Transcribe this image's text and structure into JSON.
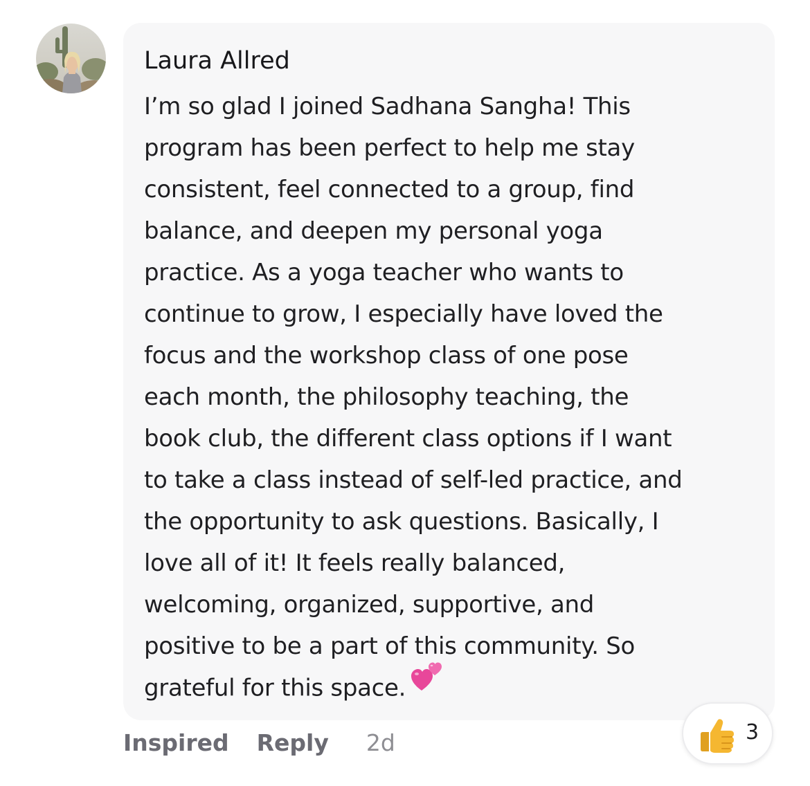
{
  "comment": {
    "author": "Laura Allred",
    "lines": [
      "I’m so glad I joined Sadhana Sangha! This",
      "program has been perfect to help me stay",
      "consistent, feel connected to a group, find",
      "balance, and deepen my personal yoga",
      "practice. As a yoga teacher who wants to",
      "continue to grow, I especially have loved the",
      "focus and the workshop class of one pose",
      "each month, the philosophy teaching, the",
      "book club, the different class options if I want",
      "to take a class instead of self-led practice, and",
      "the opportunity to ask questions. Basically, I",
      "love all of it! It feels really balanced,",
      "welcoming, organized, supportive, and",
      "positive to be a part of this community. So",
      "grateful for this space."
    ],
    "trailing_emoji": "two-hearts-icon"
  },
  "actions": {
    "inspired_label": "Inspired",
    "reply_label": "Reply",
    "timestamp": "2d"
  },
  "reaction": {
    "icon": "thumbs-up-icon",
    "count": "3"
  },
  "colors": {
    "bubble_bg": "#f7f7f8",
    "action_text": "#6b6b73",
    "timestamp_text": "#8e8e93",
    "heart_pink": "#e8479a",
    "thumb_yellow": "#f5b731"
  }
}
